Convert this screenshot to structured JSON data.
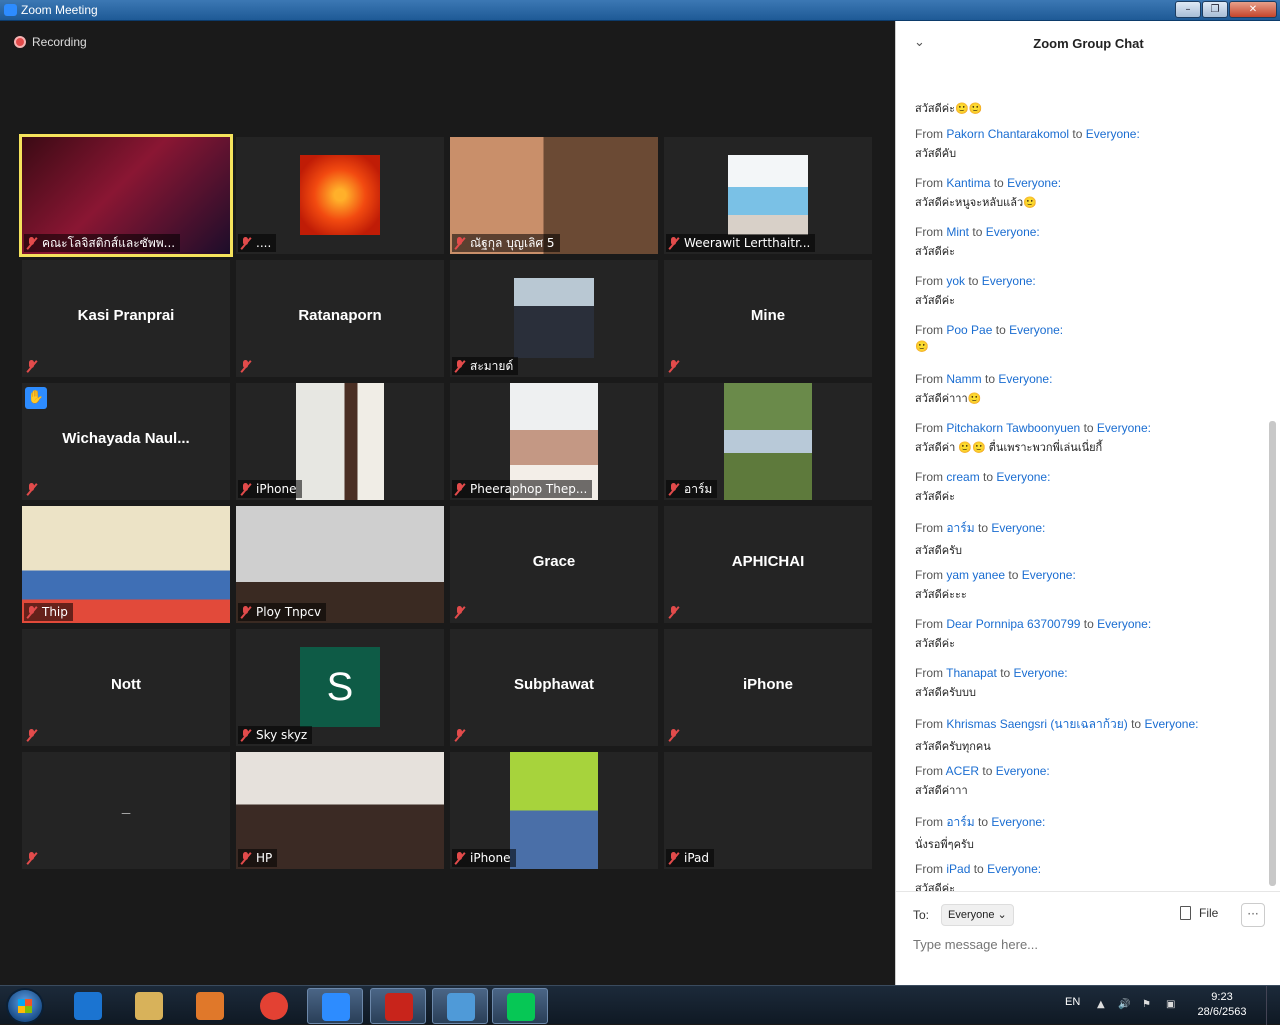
{
  "window": {
    "title": "Zoom Meeting",
    "min": "–",
    "max": "❐",
    "close": "✕"
  },
  "recording": "Recording",
  "tiles": [
    {
      "label": "คณะโลจิสติกส์และซัพพ...",
      "kind": "video",
      "active": true
    },
    {
      "label": "....",
      "kind": "photo"
    },
    {
      "label": "ณัฐกุล บุญเลิศ 5",
      "kind": "video"
    },
    {
      "label": "Weerawit Lertthaitr...",
      "kind": "photo"
    },
    {
      "center": "Kasi Pranprai",
      "kind": "name"
    },
    {
      "center": "Ratanaporn",
      "kind": "name"
    },
    {
      "label": "สะมายด์",
      "kind": "photo"
    },
    {
      "center": "Mine",
      "kind": "name"
    },
    {
      "center": "Wichayada  Naul...",
      "kind": "name",
      "hand": true
    },
    {
      "label": "iPhone",
      "kind": "video-narrow"
    },
    {
      "label": "Pheeraphop Thep...",
      "kind": "video-narrow"
    },
    {
      "label": "อาร์ม",
      "kind": "video-narrow"
    },
    {
      "label": "Thip",
      "kind": "video"
    },
    {
      "label": "Ploy Tnpcv",
      "kind": "video"
    },
    {
      "center": "Grace",
      "kind": "name"
    },
    {
      "center": "APHICHAI",
      "kind": "name"
    },
    {
      "center": "Nott",
      "kind": "name"
    },
    {
      "label": "Sky skyz",
      "kind": "avatar",
      "letter": "S"
    },
    {
      "center": "Subphawat",
      "kind": "name"
    },
    {
      "center": "iPhone",
      "kind": "name"
    },
    {
      "center": "_",
      "kind": "name"
    },
    {
      "label": "HP",
      "kind": "video"
    },
    {
      "label": "iPhone",
      "kind": "video-narrow"
    },
    {
      "label": "iPad",
      "kind": "blank"
    }
  ],
  "chat": {
    "title": "Zoom Group Chat",
    "collapse_icon": "chevron-down-icon",
    "first_text": "สวัสดีค่ะ🙂🙂",
    "messages": [
      {
        "from": "Pakorn Chantarakomol",
        "to": "Everyone:",
        "text": "สวัสดีคับ"
      },
      {
        "from": "Kantima",
        "to": "Everyone:",
        "text": "สวัสดีค่ะหนูจะหลับแล้ว🙂"
      },
      {
        "from": "Mint",
        "to": "Everyone:",
        "text": "สวัสดีค่ะ"
      },
      {
        "from": "yok",
        "to": "Everyone:",
        "text": "สวัสดีค่ะ"
      },
      {
        "from": "Poo Pae",
        "to": "Everyone:",
        "text": "🙂"
      },
      {
        "from": "Namm",
        "to": "Everyone:",
        "text": "สวัสดีค่าาา🙂"
      },
      {
        "from": "Pitchakorn Tawboonyuen",
        "to": "Everyone:",
        "text": "สวัสดีค่า 🙂🙂 ตื่นเพราะพวกพี่เล่นเนี่ยกี้"
      },
      {
        "from": "cream",
        "to": "Everyone:",
        "text": "สวัสดีค่ะ"
      },
      {
        "from": "อาร์ม",
        "to": "Everyone:",
        "text": "สวัสดีครับ"
      },
      {
        "from": "yam yanee",
        "to": "Everyone:",
        "text": "สวัสดีค่ะะะ"
      },
      {
        "from": "Dear Pornnipa 63700799",
        "to": "Everyone:",
        "text": "สวัสดีค่ะ"
      },
      {
        "from": "Thanapat",
        "to": "Everyone:",
        "text": "สวัสดีครับบบ"
      },
      {
        "from": "Khrismas Saengsri (นายเฉลาก้วย)",
        "to": "Everyone:",
        "text": "สวัสดีครับทุกคน"
      },
      {
        "from": "ACER",
        "to": "Everyone:",
        "text": "สวัสดีค่าาา"
      },
      {
        "from": "อาร์ม",
        "to": "Everyone:",
        "text": "นั่งรอพี่ๆครับ"
      },
      {
        "from": "iPad",
        "to": "Everyone:",
        "text": "สวัสดีค่ะ"
      }
    ],
    "from_word": "From",
    "to_word": "to",
    "to_label": "To:",
    "to_value": "Everyone ⌄",
    "file_label": "File",
    "more_label": "···",
    "input_placeholder": "Type message here..."
  },
  "taskbar": {
    "apps": [
      "ie-icon",
      "explorer-icon",
      "media-player-icon",
      "chrome-icon",
      "zoom-icon",
      "acrobat-icon",
      "photo-viewer-icon",
      "line-icon"
    ],
    "lang": "EN",
    "time": "9:23",
    "date": "28/6/2563"
  }
}
